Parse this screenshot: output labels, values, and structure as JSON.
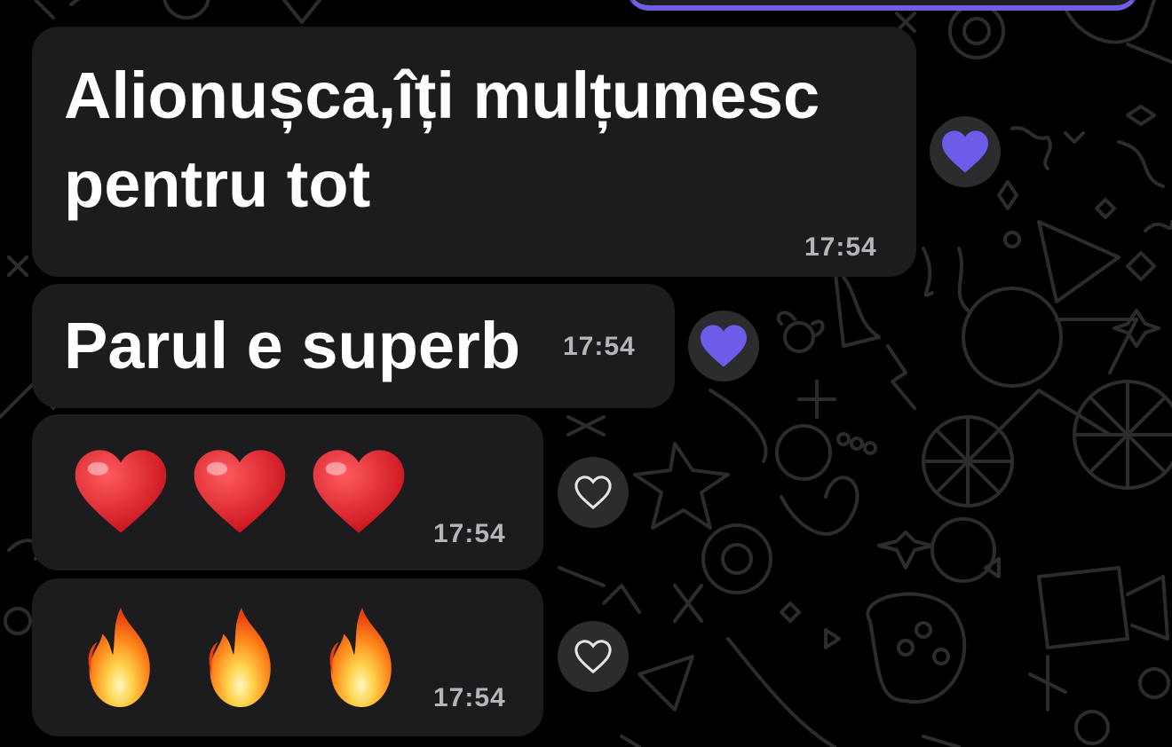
{
  "colors": {
    "background": "#000000",
    "bubble": "#1c1c1e",
    "text": "#ffffff",
    "timestamp": "#b4b4ba",
    "reaction_filled": "#6c5ce7",
    "reaction_bg": "#2c2c2e",
    "reaction_outline": "#e5e5ea",
    "heart_emoji": "#e8212b",
    "accent_outgoing": "#6f5fe0"
  },
  "messages": [
    {
      "text_line1": "Alionușca,îți mulțumesc",
      "text_line2": "pentru tot",
      "time": "17:54",
      "reaction": "purple-heart-icon",
      "reacted": true
    },
    {
      "text": "Parul e superb",
      "time": "17:54",
      "reaction": "purple-heart-icon",
      "reacted": true
    },
    {
      "emojis": [
        "red-heart-emoji",
        "red-heart-emoji",
        "red-heart-emoji"
      ],
      "time": "17:54",
      "reaction": "heart-outline-icon",
      "reacted": false
    },
    {
      "emojis": [
        "fire-emoji",
        "fire-emoji",
        "fire-emoji"
      ],
      "time": "17:54",
      "reaction": "heart-outline-icon",
      "reacted": false
    }
  ]
}
